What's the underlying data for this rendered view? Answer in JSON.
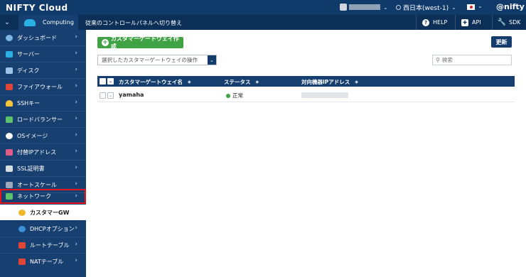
{
  "header": {
    "brand": "NIFTY Cloud",
    "region": "西日本(west-1)",
    "right_logo": "@nifty"
  },
  "subheader": {
    "tab": "Computing",
    "switch_link": "従来のコントロールパネルへ切り替え",
    "help": "HELP",
    "api": "API",
    "sdk": "SDK"
  },
  "sidebar": {
    "items": [
      {
        "label": "ダッシュボード",
        "icon": "dashboard-icon"
      },
      {
        "label": "サーバー",
        "icon": "server-icon"
      },
      {
        "label": "ディスク",
        "icon": "disk-icon"
      },
      {
        "label": "ファイアウォール",
        "icon": "firewall-icon"
      },
      {
        "label": "SSHキー",
        "icon": "key-icon"
      },
      {
        "label": "ロードバランサー",
        "icon": "load-balancer-icon"
      },
      {
        "label": "OSイメージ",
        "icon": "os-image-icon"
      },
      {
        "label": "付替IPアドレス",
        "icon": "ip-address-icon"
      },
      {
        "label": "SSL証明書",
        "icon": "ssl-certificate-icon"
      },
      {
        "label": "オートスケール",
        "icon": "autoscale-icon"
      },
      {
        "label": "ネットワーク",
        "icon": "network-icon"
      }
    ],
    "subitems": [
      {
        "label": "カスタマーGW",
        "icon": "customer-gateway-icon"
      },
      {
        "label": "DHCPオプション",
        "icon": "dhcp-icon"
      },
      {
        "label": "ルートテーブル",
        "icon": "route-table-icon"
      },
      {
        "label": "NATテーブル",
        "icon": "nat-table-icon"
      }
    ]
  },
  "main": {
    "create_button": "カスタマーゲートウェイ作成",
    "refresh_button": "更新",
    "operation_select": "選択したカスタマーゲートウェイの操作",
    "search_placeholder": "検索",
    "table": {
      "columns": [
        "カスタマーゲートウェイ名",
        "ステータス",
        "対向機器IPアドレス"
      ],
      "rows": [
        {
          "name": "yamaha",
          "status": "正常"
        }
      ]
    }
  },
  "colors": {
    "topbar": "#103a6a",
    "sidebar": "#173f6f",
    "create_button": "#3fa346",
    "highlight": "#e4151c"
  }
}
